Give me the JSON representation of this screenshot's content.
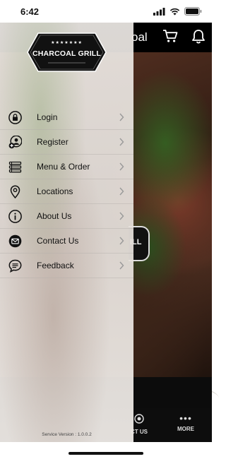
{
  "status_bar": {
    "time": "6:42",
    "icons": [
      "signal-icon",
      "wifi-icon",
      "battery-icon"
    ]
  },
  "background_app": {
    "header_title_partial": "oal",
    "header_icons": [
      "cart-icon",
      "bell-icon"
    ],
    "logo_partial_text": "ILL",
    "tabbar": {
      "contact_partial_label": "CT US",
      "more_label": "MORE",
      "more_icon": "more-dots-icon"
    }
  },
  "drawer": {
    "brand": {
      "stars": "★★★★★★★",
      "name": "CHARCOAL GRILL"
    },
    "menu_items": [
      {
        "label": "Login",
        "icon": "lock-icon"
      },
      {
        "label": "Register",
        "icon": "add-user-icon"
      },
      {
        "label": "Menu & Order",
        "icon": "menu-list-icon"
      },
      {
        "label": "Locations",
        "icon": "location-pin-icon"
      },
      {
        "label": "About Us",
        "icon": "info-icon"
      },
      {
        "label": "Contact Us",
        "icon": "envelope-icon"
      },
      {
        "label": "Feedback",
        "icon": "chat-bubble-icon"
      }
    ],
    "version_label": "Service Version : 1.0.0.2"
  },
  "colors": {
    "header_bg": "#000000",
    "drawer_overlay": "#ECE8E4",
    "text_primary": "#111111"
  }
}
